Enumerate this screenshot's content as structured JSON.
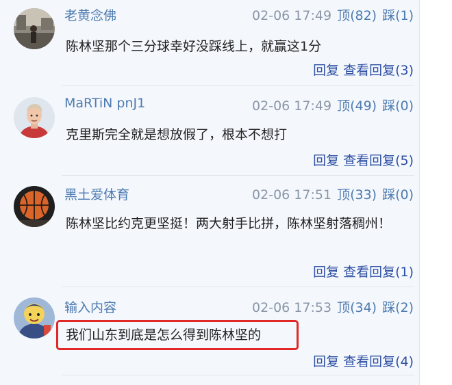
{
  "comments": [
    {
      "username": "老黄念佛",
      "datetime": "02-06 17:49",
      "up": "顶(82)",
      "down": "踩(1)",
      "text": "陈林坚那个三分球幸好没踩线上，就赢这1分",
      "reply": "回复",
      "view_replies": "查看回复(3)",
      "avatar_icon": "photo-avatar"
    },
    {
      "username": "MaRTiN pnJ1",
      "datetime": "02-06 17:49",
      "up": "顶(49)",
      "down": "踩(0)",
      "text": "克里斯完全就是想放假了，根本不想打",
      "reply": "回复",
      "view_replies": "查看回复(5)",
      "avatar_icon": "person-avatar"
    },
    {
      "username": "黑土爱体育",
      "datetime": "02-06 17:51",
      "up": "顶(33)",
      "down": "踩(0)",
      "text": "陈林坚比约克更坚挺！两大射手比拼，陈林坚射落稠州！",
      "reply": "回复",
      "view_replies": "查看回复(1)",
      "avatar_icon": "basketball-avatar"
    },
    {
      "username": "输入内容",
      "datetime": "02-06 17:53",
      "up": "顶(34)",
      "down": "踩(2)",
      "text": "我们山东到底是怎么得到陈林坚的",
      "reply": "回复",
      "view_replies": "查看回复(4)",
      "avatar_icon": "cartoon-avatar"
    }
  ],
  "colors": {
    "username": "#4d7bb0",
    "meta": "#8a96a8",
    "action_link": "#2d4fa3",
    "highlight_border": "#e02828",
    "panel_bg": "#f4f7fc"
  }
}
